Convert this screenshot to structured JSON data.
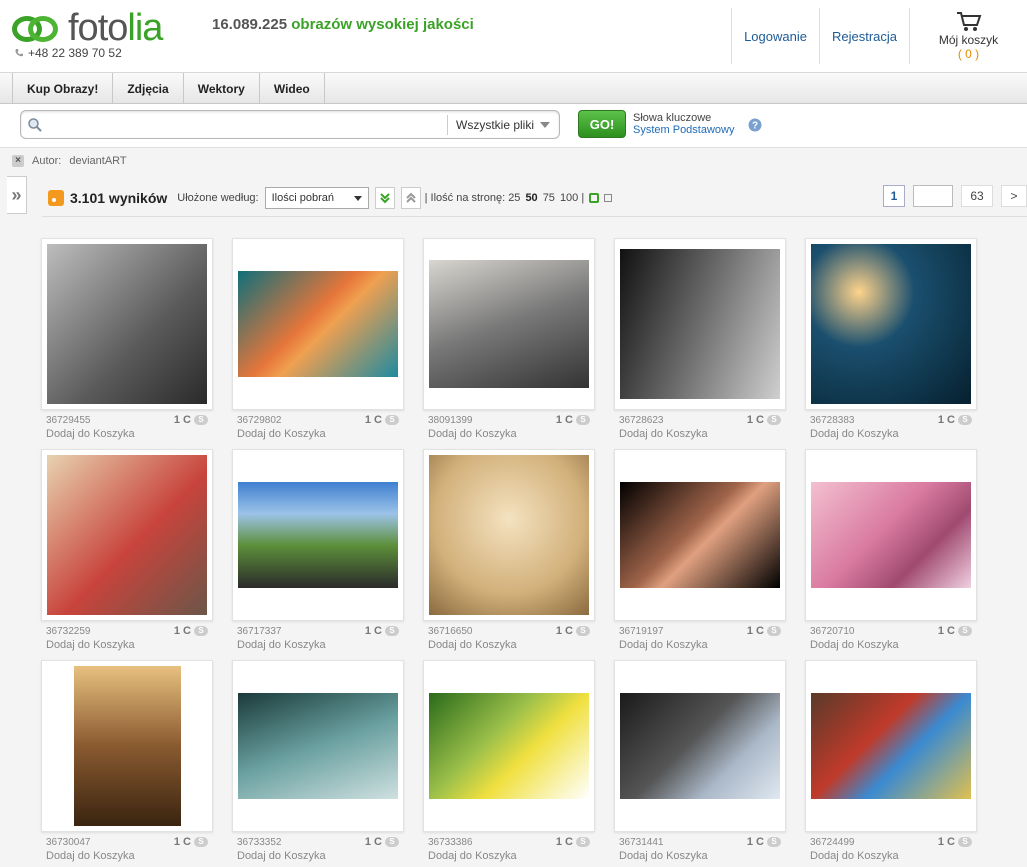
{
  "header": {
    "logo_main": "foto",
    "logo_accent": "lia",
    "phone": "+48 22 389 70 52",
    "tagline_count": "16.089.225",
    "tagline_text": " obrazów wysokiej jakości",
    "login": "Logowanie",
    "register": "Rejestracja",
    "cart_label": "Mój koszyk",
    "cart_count": "( 0 )"
  },
  "nav": {
    "tabs": [
      "Kup Obrazy!",
      "Zdjęcia",
      "Wektory",
      "Wideo"
    ]
  },
  "search": {
    "placeholder": "",
    "file_type": "Wszystkie pliki",
    "go": "GO!",
    "kw_label": "Słowa kluczowe",
    "kw_mode": "System Podstawowy"
  },
  "filter": {
    "label": "Autor:",
    "value": "deviantART"
  },
  "results": {
    "count": "3.101 wyników",
    "sorted_label": "Ułożone według:",
    "sort_value": "Ilości pobrań",
    "perpage_label": "| Ilość na stronę: 25",
    "perpage_50": "50",
    "perpage_75": "75",
    "perpage_100": "100 |",
    "page_current": "1",
    "page_total": "63",
    "page_next": ">"
  },
  "colors": {
    "accent": "#3aa227",
    "link": "#1e5b96"
  },
  "items": [
    {
      "id": "36729455",
      "price": "1 C",
      "add": "Dodaj do Koszyka"
    },
    {
      "id": "36729802",
      "price": "1 C",
      "add": "Dodaj do Koszyka"
    },
    {
      "id": "38091399",
      "price": "1 C",
      "add": "Dodaj do Koszyka"
    },
    {
      "id": "36728623",
      "price": "1 C",
      "add": "Dodaj do Koszyka"
    },
    {
      "id": "36728383",
      "price": "1 C",
      "add": "Dodaj do Koszyka"
    },
    {
      "id": "36732259",
      "price": "1 C",
      "add": "Dodaj do Koszyka"
    },
    {
      "id": "36717337",
      "price": "1 C",
      "add": "Dodaj do Koszyka"
    },
    {
      "id": "36716650",
      "price": "1 C",
      "add": "Dodaj do Koszyka"
    },
    {
      "id": "36719197",
      "price": "1 C",
      "add": "Dodaj do Koszyka"
    },
    {
      "id": "36720710",
      "price": "1 C",
      "add": "Dodaj do Koszyka"
    },
    {
      "id": "36730047",
      "price": "1 C",
      "add": "Dodaj do Koszyka"
    },
    {
      "id": "36733352",
      "price": "1 C",
      "add": "Dodaj do Koszyka"
    },
    {
      "id": "36733386",
      "price": "1 C",
      "add": "Dodaj do Koszyka"
    },
    {
      "id": "36731441",
      "price": "1 C",
      "add": "Dodaj do Koszyka"
    },
    {
      "id": "36724499",
      "price": "1 C",
      "add": "Dodaj do Koszyka"
    }
  ]
}
